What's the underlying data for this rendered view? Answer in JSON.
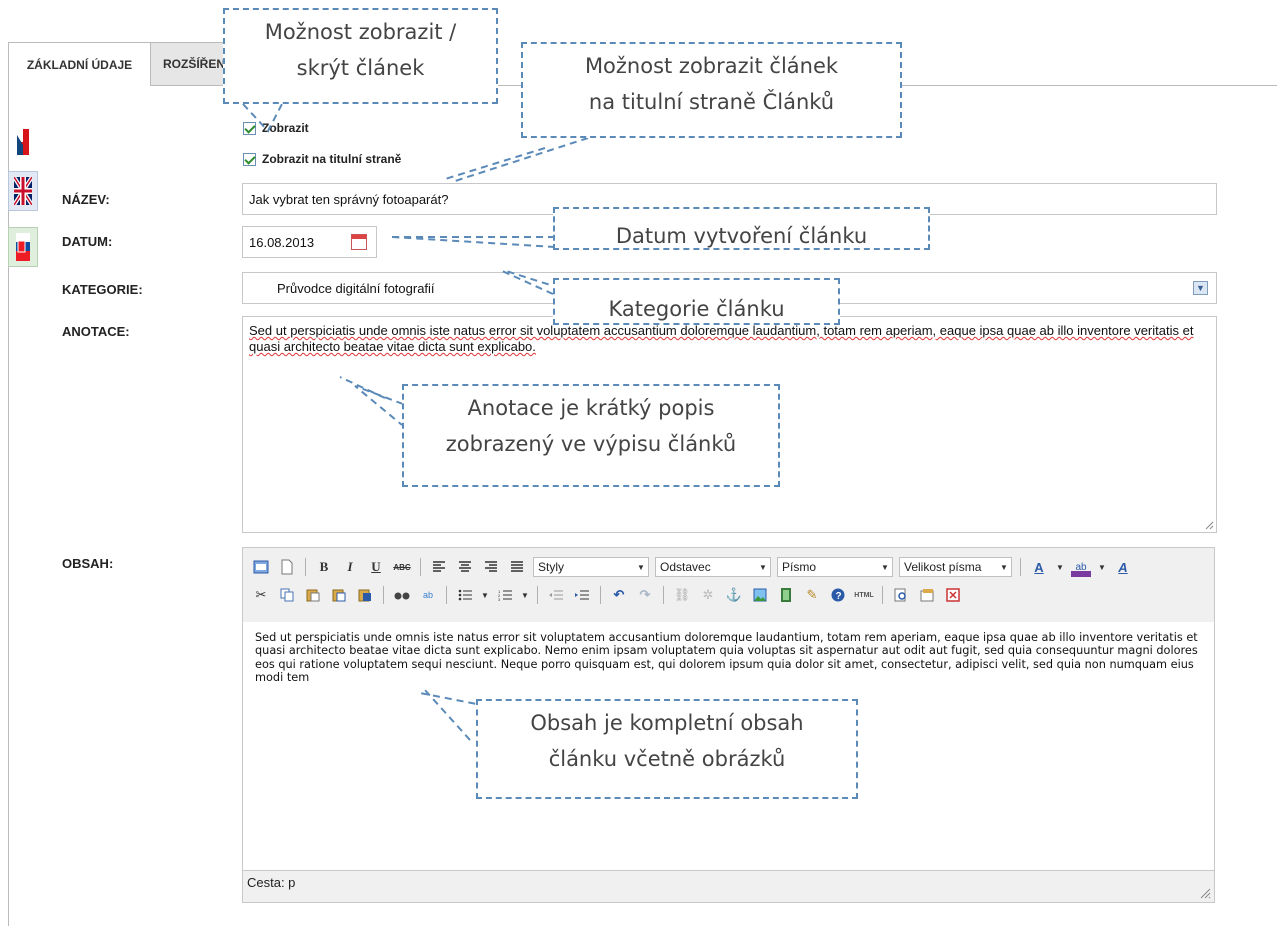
{
  "tabs": [
    {
      "label": "ZÁKLADNÍ ÚDAJE",
      "active": true
    },
    {
      "label": "ROZŠÍŘENÉ",
      "active": false
    }
  ],
  "languages": [
    {
      "icon": "czech-flag-icon"
    },
    {
      "icon": "british-flag-icon"
    },
    {
      "icon": "slovak-flag-icon"
    }
  ],
  "form": {
    "show_label": "Zobrazit",
    "show_checked": true,
    "show_front_label": "Zobrazit na titulní straně",
    "show_front_checked": true,
    "title_label": "NÁZEV:",
    "title_value": "Jak vybrat ten správný fotoaparát?",
    "date_label": "DATUM:",
    "date_value": "16.08.2013",
    "category_label": "KATEGORIE:",
    "category_value": "Průvodce digitální fotografií",
    "annotation_label": "ANOTACE:",
    "annotation_value": "Sed ut perspiciatis unde omnis iste natus error sit voluptatem accusantium doloremque laudantium, totam rem aperiam, eaque ipsa quae ab illo inventore veritatis et quasi architecto beatae vitae dicta sunt explicabo.",
    "content_label": "OBSAH:"
  },
  "editor": {
    "selects": [
      "Styly",
      "Odstavec",
      "Písmo",
      "Velikost písma"
    ],
    "content": "Sed ut perspiciatis unde omnis iste natus error sit voluptatem accusantium doloremque laudantium, totam rem aperiam, eaque ipsa quae ab illo inventore veritatis et quasi architecto beatae vitae dicta sunt explicabo. Nemo enim ipsam voluptatem quia voluptas sit aspernatur aut odit aut fugit, sed quia consequuntur magni dolores eos qui ratione voluptatem sequi nesciunt. Neque porro quisquam est, qui dolorem ipsum quia dolor sit amet, consectetur, adipisci velit, sed quia non numquam eius modi tem",
    "path": "Cesta: p"
  },
  "callouts": {
    "show": [
      "Možnost zobrazit /",
      "skrýt článek"
    ],
    "front": [
      "Možnost zobrazit článek",
      "na titulní straně Článků"
    ],
    "date": "Datum vytvoření článku",
    "category": "Kategorie článku",
    "annotation": [
      "Anotace je krátký popis",
      "zobrazený ve výpisu článků"
    ],
    "content": [
      "Obsah je kompletní obsah",
      "článku včetně obrázků"
    ]
  },
  "colors": {
    "callout_border": "#5b8ab8",
    "checkmark": "#2e8b2e"
  }
}
